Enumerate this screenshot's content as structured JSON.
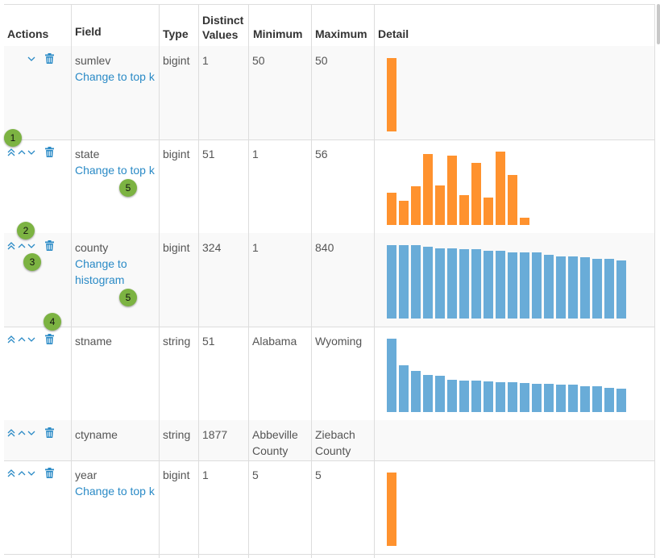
{
  "headers": {
    "actions": "Actions",
    "field": "Field",
    "type": "Type",
    "distinct_line1": "Distinct",
    "distinct_line2": "Values",
    "minimum": "Minimum",
    "maximum": "Maximum",
    "detail": "Detail"
  },
  "colors": {
    "topk_bar": "#ff922e",
    "histogram_bar": "#69acd8",
    "link": "#2a8ac6",
    "badge": "#7cb342"
  },
  "rows": [
    {
      "field": "sumlev",
      "type": "bigint",
      "distinct": "1",
      "min": "50",
      "max": "50",
      "link1": "Change to top k",
      "link2": "",
      "actions": [
        "move-down",
        "delete"
      ],
      "chart": {
        "kind": "topk",
        "values": [
          1.0
        ]
      }
    },
    {
      "field": "state",
      "type": "bigint",
      "distinct": "51",
      "min": "1",
      "max": "56",
      "link1": "Change to top k",
      "link2": "",
      "actions": [
        "move-top",
        "move-up",
        "move-down",
        "delete"
      ],
      "chart": {
        "kind": "topk",
        "values": [
          0.44,
          0.33,
          0.53,
          0.97,
          0.54,
          0.94,
          0.41,
          0.85,
          0.37,
          1.0,
          0.68,
          0.1
        ]
      }
    },
    {
      "field": "county",
      "type": "bigint",
      "distinct": "324",
      "min": "1",
      "max": "840",
      "link1": "Change to",
      "link2": "histogram",
      "actions": [
        "move-top",
        "move-up",
        "move-down",
        "delete"
      ],
      "chart": {
        "kind": "histogram",
        "values": [
          1.0,
          1.0,
          1.0,
          0.98,
          0.96,
          0.96,
          0.94,
          0.94,
          0.92,
          0.92,
          0.9,
          0.9,
          0.9,
          0.87,
          0.85,
          0.85,
          0.83,
          0.81,
          0.81,
          0.79
        ]
      }
    },
    {
      "field": "stname",
      "type": "string",
      "distinct": "51",
      "min": "Alabama",
      "max": "Wyoming",
      "link1": "",
      "link2": "",
      "actions": [
        "move-top",
        "move-up",
        "move-down",
        "delete"
      ],
      "chart": {
        "kind": "histogram",
        "values": [
          1.0,
          0.64,
          0.56,
          0.51,
          0.49,
          0.44,
          0.43,
          0.43,
          0.42,
          0.41,
          0.41,
          0.4,
          0.39,
          0.38,
          0.37,
          0.37,
          0.35,
          0.35,
          0.33,
          0.32
        ]
      }
    },
    {
      "field": "ctyname",
      "type": "string",
      "distinct": "1877",
      "min": "Abbeville County",
      "max": "Ziebach County",
      "min_l1": "Abbeville",
      "min_l2": "County",
      "max_l1": "Ziebach",
      "max_l2": "County",
      "link1": "",
      "link2": "",
      "actions": [
        "move-top",
        "move-up",
        "move-down",
        "delete"
      ],
      "chart": null
    },
    {
      "field": "year",
      "type": "bigint",
      "distinct": "1",
      "min": "5",
      "max": "5",
      "link1": "Change to top k",
      "link2": "",
      "actions": [
        "move-top",
        "move-up",
        "move-down",
        "delete"
      ],
      "chart": {
        "kind": "topk",
        "values": [
          1.0
        ]
      }
    }
  ],
  "badges": [
    {
      "label": "1"
    },
    {
      "label": "2"
    },
    {
      "label": "3"
    },
    {
      "label": "4"
    },
    {
      "label": "5"
    },
    {
      "label": "5"
    }
  ]
}
